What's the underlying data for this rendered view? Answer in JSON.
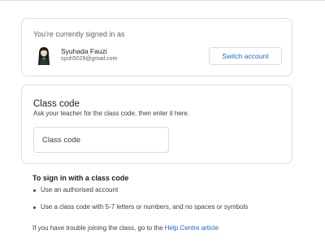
{
  "account": {
    "signed_in_label": "You're currently signed in as",
    "name": "Syuhada Fauzi",
    "email": "syuh5029@gmail.com",
    "switch_button": "Switch account"
  },
  "class_code": {
    "title": "Class code",
    "description": "Ask your teacher for the class code, then enter it here.",
    "input_placeholder": "Class code",
    "input_value": ""
  },
  "help": {
    "title": "To sign in with a class code",
    "items": [
      "Use an authorised account",
      "Use a class code with 5-7 letters or numbers, and no spaces or symbols"
    ],
    "trouble_text": "If you have trouble joining the class, go to the ",
    "link_text": "Help Centre article"
  },
  "colors": {
    "accent": "#1967d2",
    "border": "#dadce0",
    "text": "#3c4043"
  }
}
